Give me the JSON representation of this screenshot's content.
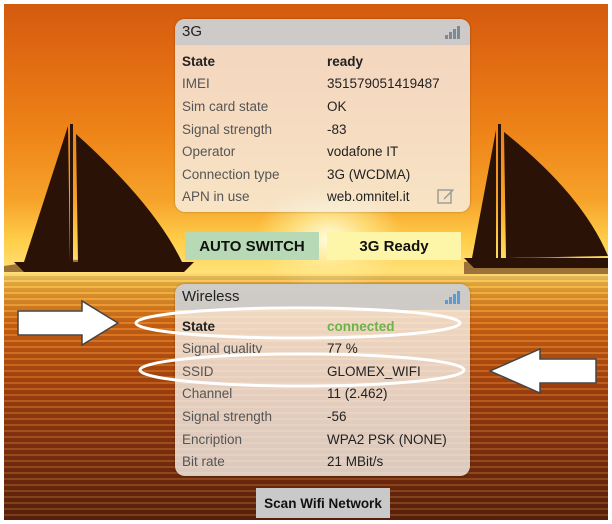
{
  "g3": {
    "title": "3G",
    "icon": "signal-bars-icon",
    "rows": [
      {
        "label": "State",
        "value": "ready"
      },
      {
        "label": "IMEI",
        "value": "351579051419487"
      },
      {
        "label": "Sim card state",
        "value": "OK"
      },
      {
        "label": "Signal strength",
        "value": "-83"
      },
      {
        "label": "Operator",
        "value": "vodafone IT"
      },
      {
        "label": "Connection type",
        "value": "3G (WCDMA)"
      },
      {
        "label": "APN in use",
        "value": "web.omnitel.it"
      }
    ],
    "edit_icon": "edit-icon"
  },
  "buttons": {
    "auto_switch": "AUTO SWITCH",
    "ready_3g": "3G Ready",
    "scan": "Scan Wifi Network"
  },
  "wireless": {
    "title": "Wireless",
    "icon": "signal-bars-icon",
    "rows": [
      {
        "label": "State",
        "value": "connected"
      },
      {
        "label": "Signal quality",
        "value": "77 %"
      },
      {
        "label": "SSID",
        "value": "GLOMEX_WIFI"
      },
      {
        "label": "Channel",
        "value": "11 (2.462)"
      },
      {
        "label": "Signal strength",
        "value": "-56"
      },
      {
        "label": "Encription",
        "value": "WPA2 PSK (NONE)"
      },
      {
        "label": "Bit rate",
        "value": "21 MBit/s"
      }
    ]
  },
  "colors": {
    "connected": "#6bb24a",
    "auto_switch_bg": "#b8d9b6",
    "ready_3g_bg": "#fdf6a8",
    "scan_bg": "#c9c9c9"
  }
}
